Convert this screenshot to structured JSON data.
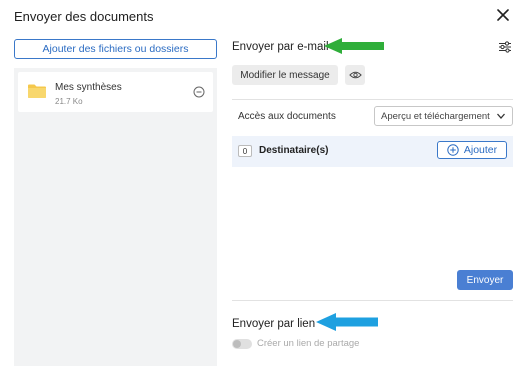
{
  "dialog": {
    "title": "Envoyer des documents",
    "close_icon": "close-icon"
  },
  "left": {
    "add_files_label": "Ajouter des fichiers ou dossiers",
    "files": [
      {
        "name": "Mes synthèses",
        "size": "21.7 Ko",
        "icon": "folder-icon"
      }
    ]
  },
  "email": {
    "title": "Envoyer par e-mail",
    "modify_label": "Modifier le message",
    "access_label": "Accès aux documents",
    "access_value": "Aperçu et téléchargement",
    "recipients_count": "0",
    "recipients_label": "Destinataire(s)",
    "add_label": "Ajouter",
    "send_label": "Envoyer"
  },
  "link": {
    "title": "Envoyer par lien",
    "toggle_label": "Créer un lien de partage",
    "toggle_on": false
  },
  "colors": {
    "accent": "#3a78c9",
    "send_button": "#4a7fd3",
    "recipients_bg": "#eef3fb",
    "annotation_green": "#2fae3a",
    "annotation_blue": "#1ea0e0"
  }
}
